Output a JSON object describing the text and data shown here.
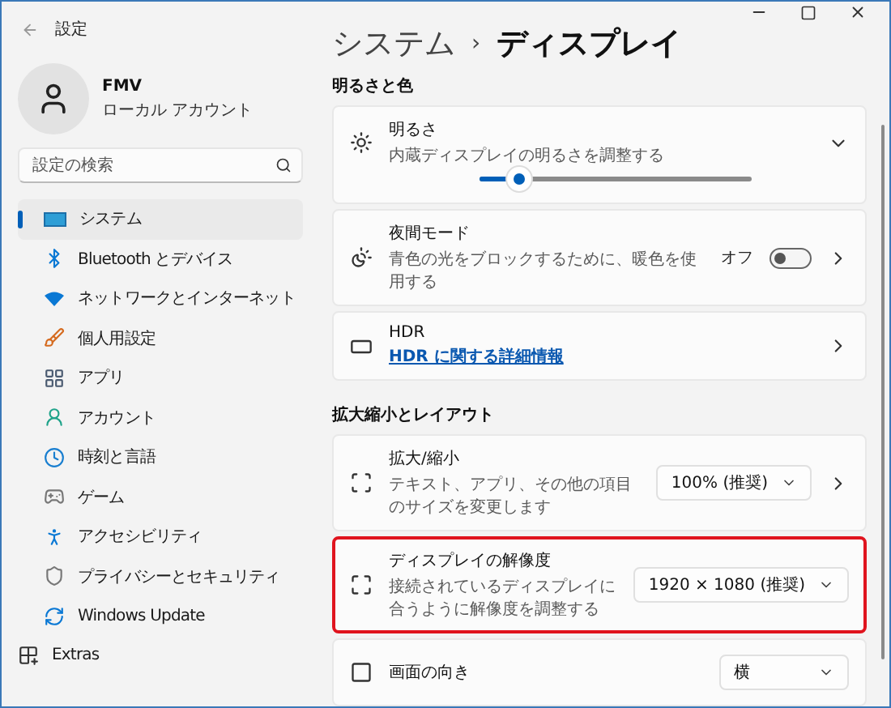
{
  "window": {
    "title": "設定"
  },
  "account": {
    "name": "FMV",
    "type": "ローカル アカウント"
  },
  "search": {
    "placeholder": "設定の検索"
  },
  "nav": [
    {
      "label": "システム",
      "selected": true
    },
    {
      "label": "Bluetooth とデバイス",
      "selected": false
    },
    {
      "label": "ネットワークとインターネット",
      "selected": false
    },
    {
      "label": "個人用設定",
      "selected": false
    },
    {
      "label": "アプリ",
      "selected": false
    },
    {
      "label": "アカウント",
      "selected": false
    },
    {
      "label": "時刻と言語",
      "selected": false
    },
    {
      "label": "ゲーム",
      "selected": false
    },
    {
      "label": "アクセシビリティ",
      "selected": false
    },
    {
      "label": "プライバシーとセキュリティ",
      "selected": false
    },
    {
      "label": "Windows Update",
      "selected": false
    },
    {
      "label": "Extras",
      "selected": false
    }
  ],
  "breadcrumb": {
    "parent": "システム",
    "separator": "›",
    "current": "ディスプレイ"
  },
  "sections": [
    {
      "title": "明るさと色",
      "cards": [
        {
          "kind": "slider",
          "title": "明るさ",
          "description": "内蔵ディスプレイの明るさを調整する",
          "level": 0.14,
          "highlighted": false
        },
        {
          "kind": "toggle",
          "title": "夜間モード",
          "description": "青色の光をブロックするために、暖色を使用する",
          "state_label": "オフ",
          "on": false,
          "highlighted": false
        },
        {
          "kind": "link",
          "title": "HDR",
          "link": "HDR に関する詳細情報",
          "highlighted": false
        }
      ]
    },
    {
      "title": "拡大縮小とレイアウト",
      "cards": [
        {
          "kind": "dropdown",
          "title": "拡大/縮小",
          "description": "テキスト、アプリ、その他の項目のサイズを変更します",
          "value": "100% (推奨)",
          "chevron": true,
          "highlighted": false
        },
        {
          "kind": "dropdown",
          "title": "ディスプレイの解像度",
          "description": "接続されているディスプレイに合うように解像度を調整する",
          "value": "1920 × 1080 (推奨)",
          "chevron": false,
          "highlighted": true
        },
        {
          "kind": "dropdown",
          "title": "画面の向き",
          "value": "横",
          "chevron": false,
          "highlighted": false
        }
      ]
    }
  ]
}
